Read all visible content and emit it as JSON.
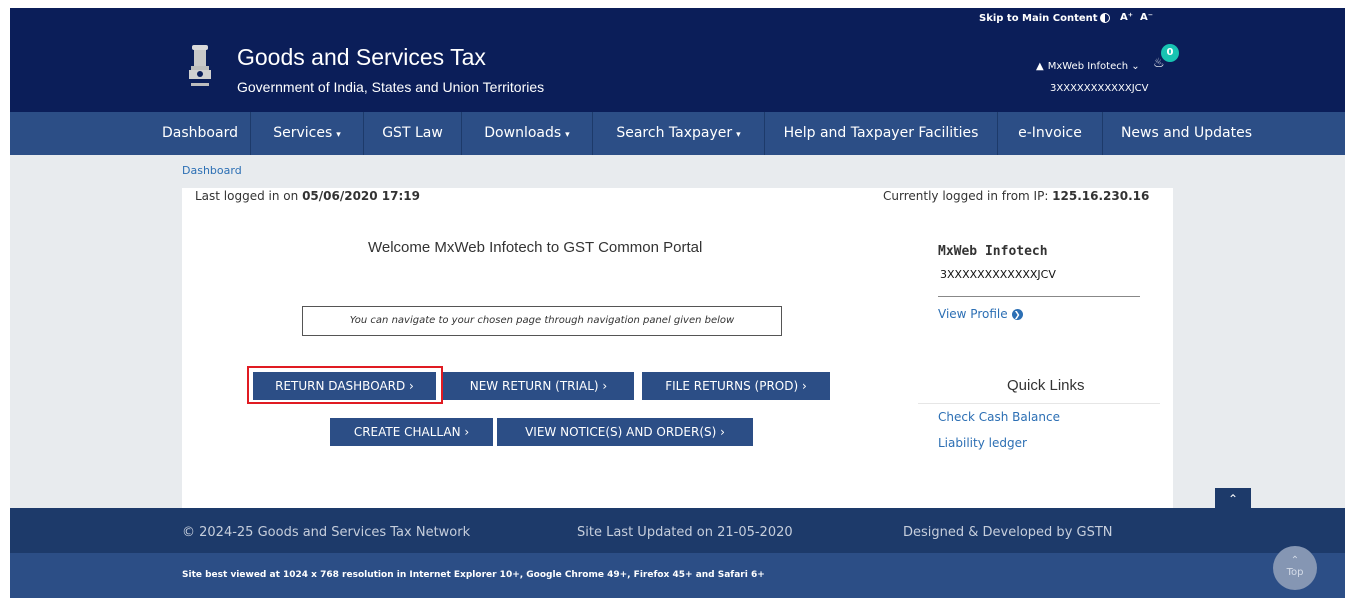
{
  "accessibility": {
    "skip_link": "Skip to Main Content",
    "font_increase": "A⁺",
    "font_decrease": "A⁻"
  },
  "header": {
    "title": "Goods and Services Tax",
    "subtitle": "Government of India, States and Union Territories",
    "user_name": "MxWeb Infotech",
    "user_caret": "⌄",
    "gstin": "3XXXXXXXXXXXJCV",
    "notification_count": "0"
  },
  "nav": {
    "items": [
      {
        "label": "Dashboard"
      },
      {
        "label": "Services",
        "dropdown": true
      },
      {
        "label": "GST Law"
      },
      {
        "label": "Downloads",
        "dropdown": true
      },
      {
        "label": "Search Taxpayer",
        "dropdown": true
      },
      {
        "label": "Help and Taxpayer Facilities"
      },
      {
        "label": "e-Invoice"
      },
      {
        "label": "News and Updates"
      }
    ],
    "caret": "▾"
  },
  "breadcrumb": "Dashboard",
  "login_info": {
    "last_logged_prefix": "Last logged in on ",
    "last_logged_value": "05/06/2020 17:19",
    "ip_prefix": "Currently logged in from IP: ",
    "ip_value": "125.16.230.16"
  },
  "main": {
    "welcome": "Welcome MxWeb Infotech to GST Common Portal",
    "nav_hint": "You can navigate to your chosen page through navigation panel given below",
    "buttons": {
      "return_dashboard": "RETURN DASHBOARD ›",
      "new_return": "NEW RETURN (TRIAL) ›",
      "file_returns": "FILE RETURNS (PROD) ›",
      "create_challan": "CREATE CHALLAN ›",
      "view_notices": "VIEW NOTICE(S) AND ORDER(S) ›"
    }
  },
  "profile": {
    "name": "MxWeb Infotech",
    "gstin": "3XXXXXXXXXXXXJCV",
    "view_profile": "View Profile",
    "arrow": "❯"
  },
  "quick_links": {
    "title": "Quick Links",
    "items": [
      "Check Cash Balance",
      "Liability ledger"
    ]
  },
  "footer": {
    "copyright": "© 2024-25 Goods and Services Tax Network",
    "last_updated": "Site Last Updated on 21-05-2020",
    "designed_by": "Designed & Developed by GSTN",
    "browsers": "Site best viewed at 1024 x 768 resolution in Internet Explorer 10+, Google Chrome 49+, Firefox 45+ and Safari 6+",
    "up_arrow": "⌃",
    "top_label": "Top"
  },
  "colors": {
    "header_bg": "#0b1e59",
    "nav_bg": "#2c4e86",
    "button_bg": "#2c4e86",
    "highlight_border": "#e01b22",
    "link": "#2c6fb4",
    "badge": "#18c3b2"
  }
}
